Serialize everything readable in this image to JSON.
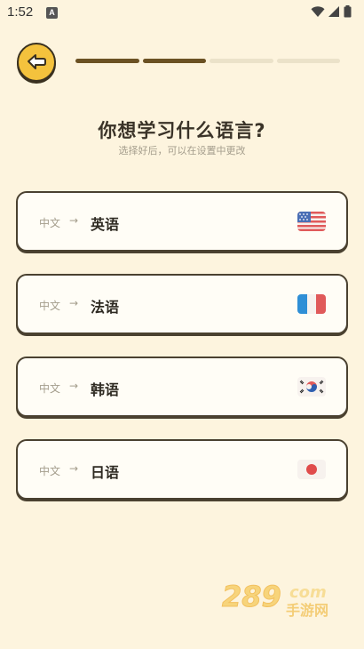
{
  "status_bar": {
    "time": "1:52",
    "app_icon_letter": "A"
  },
  "header": {
    "progress": {
      "completed_steps": 2,
      "total_steps": 4
    }
  },
  "heading": {
    "title": "你想学习什么语言?",
    "subtitle": "选择好后，可以在设置中更改"
  },
  "options": [
    {
      "from": "中文",
      "arrow": "→",
      "to": "英语",
      "flag": "us-flag-icon"
    },
    {
      "from": "中文",
      "arrow": "→",
      "to": "法语",
      "flag": "france-flag-icon"
    },
    {
      "from": "中文",
      "arrow": "→",
      "to": "韩语",
      "flag": "korea-flag-icon"
    },
    {
      "from": "中文",
      "arrow": "→",
      "to": "日语",
      "flag": "japan-flag-icon"
    }
  ],
  "watermark": {
    "brand": "289",
    "domain": "com",
    "sub": "手游网"
  },
  "colors": {
    "background": "#fdf4de",
    "accent_yellow": "#f4c23d",
    "progress_done": "#6b5123",
    "progress_todo": "#ebe2c9",
    "border": "#4a4130"
  }
}
